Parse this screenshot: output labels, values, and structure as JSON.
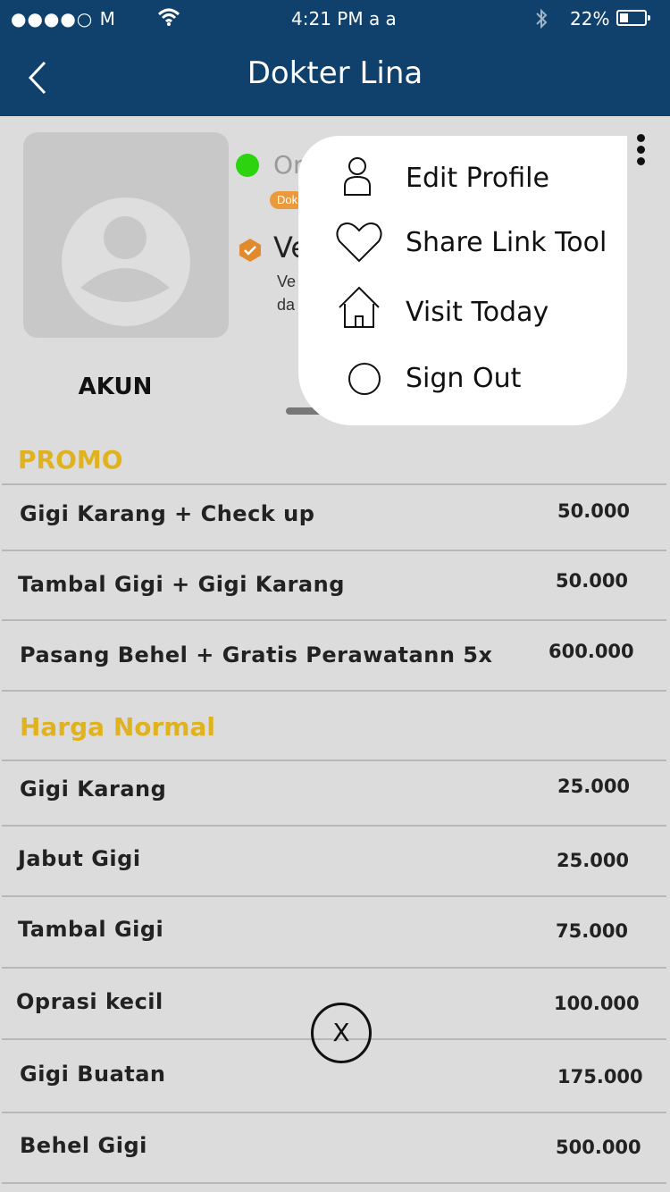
{
  "status_bar": {
    "carrier": "●●●●○ M",
    "time": "4:21 PM  a a",
    "battery": "22%"
  },
  "nav": {
    "title": "Dokter Lina"
  },
  "profile": {
    "status": "Or",
    "tag": "Dok",
    "verify_title": "Ve",
    "verify_desc_line1": "Ve",
    "verify_desc_line2": "da",
    "tab_label": "AKUN"
  },
  "menu": {
    "items": [
      {
        "label": "Edit Profile",
        "icon": "person-icon"
      },
      {
        "label": "Share Link Tool",
        "icon": "heart-icon"
      },
      {
        "label": "Visit Today",
        "icon": "home-icon"
      },
      {
        "label": "Sign Out",
        "icon": "circle-icon"
      }
    ]
  },
  "promo": {
    "title": "PROMO",
    "rows": [
      {
        "name": "Gigi Karang + Check up",
        "price": "50.000"
      },
      {
        "name": "Tambal Gigi + Gigi Karang",
        "price": "50.000"
      },
      {
        "name": "Pasang Behel + Gratis Perawatann 5x",
        "price": "600.000"
      }
    ]
  },
  "normal": {
    "title": "Harga Normal",
    "rows": [
      {
        "name": "Gigi Karang",
        "price": "25.000"
      },
      {
        "name": "Jabut Gigi",
        "price": "25.000"
      },
      {
        "name": "Tambal Gigi",
        "price": "75.000"
      },
      {
        "name": "Oprasi kecil",
        "price": "100.000"
      },
      {
        "name": "Gigi Buatan",
        "price": "175.000"
      },
      {
        "name": "Behel Gigi",
        "price": "500.000"
      }
    ]
  },
  "close_label": "X",
  "colors": {
    "header": "#0f416c",
    "accent": "#e0b21e",
    "online": "#2bd40f",
    "tag": "#ea9a3c"
  }
}
